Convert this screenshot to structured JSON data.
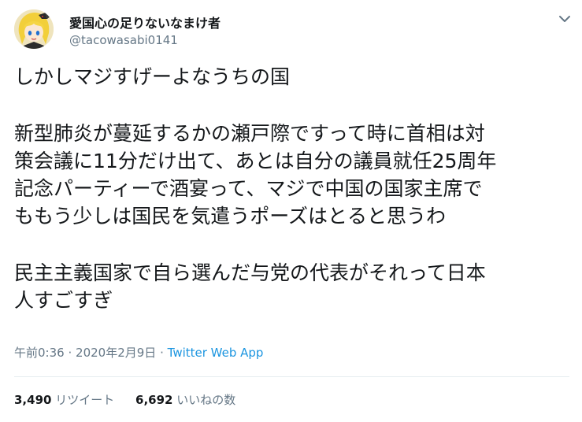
{
  "user": {
    "display_name": "愛国心の足りないなまけ者",
    "handle": "@tacowasabi0141",
    "avatar": "avatar-image"
  },
  "menu": {
    "icon": "chevron-down-icon"
  },
  "tweet": {
    "lines": [
      "しかしマジすげーよなうちの国",
      "新型肺炎が蔓延するかの瀬戸際ですって時に首相は対",
      "策会議に11分だけ出て、あとは自分の議員就任25周年",
      "記念パーティーで酒宴って、マジで中国の国家主席で",
      "ももう少しは国民を気遣うポーズはとると思うわ",
      "民主主義国家で自ら選んだ与党の代表がそれって日本",
      "人すごすぎ"
    ]
  },
  "meta": {
    "time": "午前0:36",
    "separator": "·",
    "date": "2020年2月9日",
    "app": "Twitter Web App"
  },
  "stats": {
    "retweets_count": "3,490",
    "retweets_label": "リツイート",
    "likes_count": "6,692",
    "likes_label": "いいねの数"
  },
  "colors": {
    "text": "#14171a",
    "muted": "#657786",
    "link": "#1b95e0",
    "divider": "#e6ecf0"
  }
}
